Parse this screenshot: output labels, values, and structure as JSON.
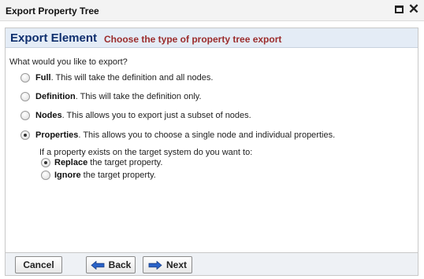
{
  "window": {
    "title": "Export Property Tree",
    "maximize_icon": "maximize-icon",
    "close_icon": "close-icon",
    "close_glyph": "✕"
  },
  "header": {
    "title": "Export Element",
    "subtitle": "Choose the type of property tree export"
  },
  "question": "What would you like to export?",
  "options": [
    {
      "name": "Full",
      "desc": ". This will take the definition and all nodes.",
      "checked": false
    },
    {
      "name": "Definition",
      "desc": ". This will take the definition only.",
      "checked": false
    },
    {
      "name": "Nodes",
      "desc": ". This allows you to export just a subset of nodes.",
      "checked": false
    },
    {
      "name": "Properties",
      "desc": ". This allows you to choose a single node and individual properties.",
      "checked": true
    }
  ],
  "sub_question": "If a property exists on the target system do you want to:",
  "sub_options": [
    {
      "name": "Replace",
      "desc": " the target property.",
      "checked": true
    },
    {
      "name": "Ignore",
      "desc": " the target property.",
      "checked": false
    }
  ],
  "footer": {
    "cancel_label": "Cancel",
    "back_label": "Back",
    "next_label": "Next",
    "arrow_color": "#2a63c8"
  }
}
